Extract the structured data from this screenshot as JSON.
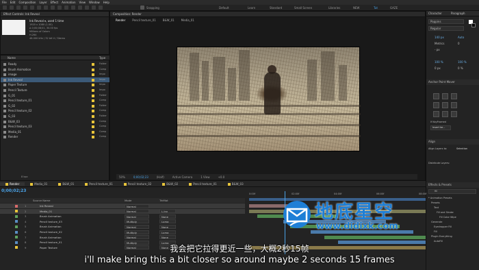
{
  "menu": {
    "items": [
      "File",
      "Edit",
      "Composition",
      "Layer",
      "Effect",
      "Animation",
      "View",
      "Window",
      "Help"
    ]
  },
  "toolbar": {
    "snapping_label": "Snapping",
    "workspaces": [
      "Default",
      "Learn",
      "Standard",
      "Small Screen",
      "Libraries",
      "NEW",
      "Tut",
      "GAZE"
    ],
    "active_workspace": "Tut"
  },
  "effect_controls": {
    "tab_label": "Effect Controls: Ink Reveal",
    "item_name": "Ink Reveal ▾, used 1 time",
    "info_lines": [
      "1920 x 1080 (1.00)",
      "Δ 0;00;08;01, 30.00 fps",
      "Millions of Colors",
      "H.264",
      "48.000 kHz / 32 bit U / Stereo"
    ]
  },
  "project": {
    "col_name": "Name",
    "col_type": "Type",
    "items": [
      {
        "name": "Ready",
        "type": "Folder",
        "color": "#e8c53a"
      },
      {
        "name": "Brush Animation",
        "type": "Comp",
        "color": "#e8c53a"
      },
      {
        "name": "image",
        "type": "Impo",
        "color": "#e8c53a"
      },
      {
        "name": "Ink Reveal",
        "type": "Impo",
        "color": "#e8c53a",
        "selected": true
      },
      {
        "name": "Paper Texture",
        "type": "Impo",
        "color": "#e8c53a"
      },
      {
        "name": "Pencil Texture",
        "type": "Impo",
        "color": "#e8c53a"
      },
      {
        "name": "G_01",
        "type": "Folder",
        "color": "#e8c53a"
      },
      {
        "name": "Pencil texture_01",
        "type": "Comp",
        "color": "#e8c53a"
      },
      {
        "name": "G_02",
        "type": "Folder",
        "color": "#e8c53a"
      },
      {
        "name": "Pencil texture_02",
        "type": "Comp",
        "color": "#e8c53a"
      },
      {
        "name": "G_03",
        "type": "Folder",
        "color": "#e8c53a"
      },
      {
        "name": "B&W_03",
        "type": "Comp",
        "color": "#e8c53a"
      },
      {
        "name": "Pencil texture_03",
        "type": "Comp",
        "color": "#e8c53a"
      },
      {
        "name": "Media_01",
        "type": "Comp",
        "color": "#e8c53a"
      },
      {
        "name": "Render",
        "type": "Comp",
        "color": "#e8c53a"
      }
    ],
    "footer": "8 bpc"
  },
  "composition": {
    "panel_title": "Composition: Render",
    "tabs": [
      "Render",
      "Pencil texture_01",
      "B&W_01",
      "Media_01"
    ],
    "zoom": "50%",
    "timecode": "0;00;02;23",
    "resolution": "(Half)",
    "camera": "Active Camera",
    "views": "1 View",
    "exposure": "+0.0"
  },
  "timeline": {
    "tabs": [
      {
        "label": "Render",
        "color": "#e8c53a",
        "active": true
      },
      {
        "label": "Media_01",
        "color": "#e8c53a"
      },
      {
        "label": "B&W_01",
        "color": "#e8c53a"
      },
      {
        "label": "Pencil texture_01",
        "color": "#e8c53a"
      },
      {
        "label": "Pencil texture_02",
        "color": "#e8c53a"
      },
      {
        "label": "B&W_02",
        "color": "#e8c53a"
      },
      {
        "label": "Pencil texture_01",
        "color": "#e8c53a"
      },
      {
        "label": "B&W_03",
        "color": "#e8c53a"
      }
    ],
    "current_time": "0;00;02;23",
    "headers": {
      "source": "Source Name",
      "mode": "Mode",
      "trkmat": "TrkMat"
    },
    "ruler": [
      "0:00f",
      "02:00f",
      "04:00f",
      "06:00f",
      "08:00f"
    ],
    "layers": [
      {
        "num": "1",
        "name": "Ink Reveal",
        "mode": "Normal",
        "trk": "",
        "color": "#d86b6b",
        "bar": "#8a6a6a"
      },
      {
        "num": "2",
        "name": "Media_01",
        "mode": "Normal",
        "trk": "L.Inv",
        "color": "#e8c53a",
        "bar": "#7a7a55"
      },
      {
        "num": "3",
        "name": "Brush Animation",
        "mode": "Normal",
        "trk": "None",
        "color": "#5fa35f",
        "bar": "#4f8a4f"
      },
      {
        "num": "4",
        "name": "Pencil texture_03",
        "mode": "Multiply",
        "trk": "Luma",
        "color": "#5a8ec4",
        "bar": "#4a7aaa"
      },
      {
        "num": "5",
        "name": "Brush Animation",
        "mode": "Normal",
        "trk": "None",
        "color": "#5fa35f",
        "bar": "#4f8a4f"
      },
      {
        "num": "6",
        "name": "Pencil texture_02",
        "mode": "Multiply",
        "trk": "Luma",
        "color": "#5a8ec4",
        "bar": "#4a7aaa"
      },
      {
        "num": "7",
        "name": "Brush Animation",
        "mode": "Normal",
        "trk": "None",
        "color": "#5fa35f",
        "bar": "#4f8a4f"
      },
      {
        "num": "8",
        "name": "Pencil texture_01",
        "mode": "Multiply",
        "trk": "Luma",
        "color": "#5a8ec4",
        "bar": "#4a7aaa"
      },
      {
        "num": "9",
        "name": "Paper Texture",
        "mode": "Normal",
        "trk": "None",
        "color": "#e8c53a",
        "bar": "#8a7a4a"
      }
    ]
  },
  "character": {
    "tab_label": "Character",
    "tab2_label": "Paragraph",
    "font": "Poppins",
    "style": "Regular",
    "size": "140 px",
    "leading": "Auto",
    "kerning": "Metrics",
    "tracking": "0",
    "stroke": "- px",
    "vscale": "100 %",
    "hscale": "100 %",
    "baseline": "0 px",
    "tsume": "0 %"
  },
  "anchor": {
    "title": "Anchor Point Mover",
    "keyframe_label": "If KeyFramed",
    "insert_label": "Insert ke..."
  },
  "align": {
    "title": "Align",
    "align_to_label": "Align Layers to:",
    "align_to_value": "Selection",
    "distribute_label": "Distribute Layers:"
  },
  "effects": {
    "title": "Effects & Presets",
    "search": "fill",
    "tree": [
      "* Animation Presets",
      "Presets",
      "Text",
      "Fill and Stroke",
      "Fill Color Wipe",
      "Generate",
      "Eyedropper Fill",
      "Fill",
      "Plugin Everything",
      "AutoFill"
    ]
  },
  "subtitles": {
    "chinese": "我会把它拉得更近一些，大概2秒15帧",
    "english": "i'll make bring this a bit closer so around maybe 2 seconds 15 frames"
  },
  "watermark": {
    "chinese": "地底星空",
    "url": "www.didixk.com",
    "accent": "#1e7fd6"
  }
}
